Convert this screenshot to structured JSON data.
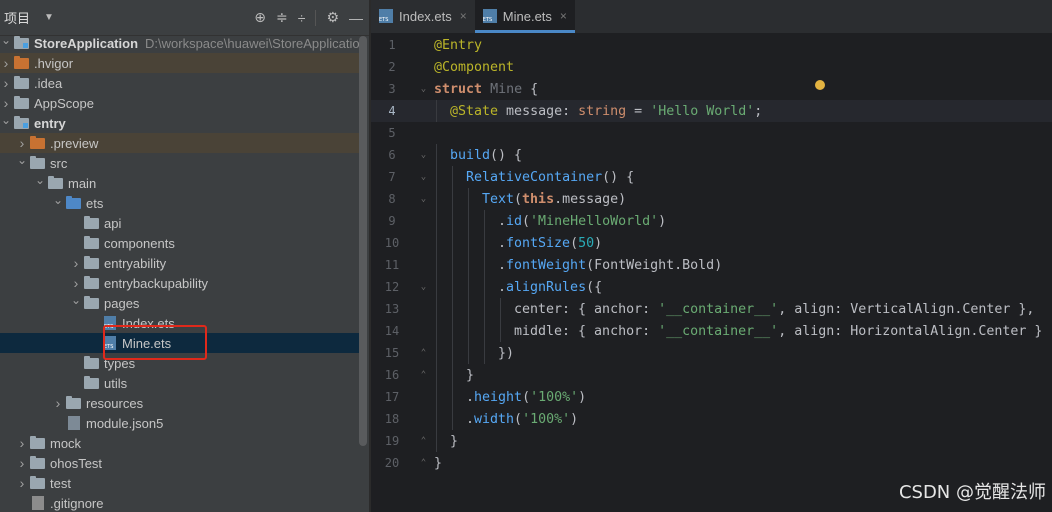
{
  "project": {
    "title": "项目",
    "dropdown_icon": "triangle-down-icon",
    "tools": [
      "locate-icon",
      "expand-all-icon",
      "collapse-all-icon",
      "settings-icon",
      "minimize-icon"
    ],
    "tree": [
      {
        "indent": 0,
        "arrow": "v",
        "icon": "module",
        "label": "StoreApplication",
        "bold": true,
        "path": "D:\\workspace\\huawei\\StoreApplication"
      },
      {
        "indent": 0,
        "arrow": ">",
        "icon": "orange",
        "label": ".hvigor",
        "hl": true
      },
      {
        "indent": 0,
        "arrow": ">",
        "icon": "folder",
        "label": ".idea"
      },
      {
        "indent": 0,
        "arrow": ">",
        "icon": "folder",
        "label": "AppScope"
      },
      {
        "indent": 0,
        "arrow": "v",
        "icon": "module",
        "label": "entry",
        "bold": true
      },
      {
        "indent": 1,
        "arrow": ">",
        "icon": "orange",
        "label": ".preview",
        "hl": true
      },
      {
        "indent": 1,
        "arrow": "v",
        "icon": "folder",
        "label": "src"
      },
      {
        "indent": 2,
        "arrow": "v",
        "icon": "folder",
        "label": "main"
      },
      {
        "indent": 3,
        "arrow": "v",
        "icon": "blue",
        "label": "ets"
      },
      {
        "indent": 4,
        "arrow": "",
        "icon": "folder",
        "label": "api"
      },
      {
        "indent": 4,
        "arrow": "",
        "icon": "folder",
        "label": "components"
      },
      {
        "indent": 4,
        "arrow": ">",
        "icon": "folder",
        "label": "entryability"
      },
      {
        "indent": 4,
        "arrow": ">",
        "icon": "folder",
        "label": "entrybackupability"
      },
      {
        "indent": 4,
        "arrow": "v",
        "icon": "folder",
        "label": "pages"
      },
      {
        "indent": 5,
        "arrow": "",
        "icon": "ets",
        "label": "Index.ets"
      },
      {
        "indent": 5,
        "arrow": "",
        "icon": "ets",
        "label": "Mine.ets",
        "sel": true
      },
      {
        "indent": 4,
        "arrow": "",
        "icon": "folder",
        "label": "types"
      },
      {
        "indent": 4,
        "arrow": "",
        "icon": "folder",
        "label": "utils"
      },
      {
        "indent": 3,
        "arrow": ">",
        "icon": "folder",
        "label": "resources"
      },
      {
        "indent": 3,
        "arrow": "",
        "icon": "json",
        "label": "module.json5"
      },
      {
        "indent": 1,
        "arrow": ">",
        "icon": "folder",
        "label": "mock"
      },
      {
        "indent": 1,
        "arrow": ">",
        "icon": "folder",
        "label": "ohosTest"
      },
      {
        "indent": 1,
        "arrow": ">",
        "icon": "folder",
        "label": "test"
      },
      {
        "indent": 1,
        "arrow": "",
        "icon": "git",
        "label": ".gitignore"
      }
    ]
  },
  "tabs": [
    {
      "label": "Index.ets",
      "active": false,
      "close": "×"
    },
    {
      "label": "Mine.ets",
      "active": true,
      "close": "×"
    }
  ],
  "code": [
    {
      "n": "1",
      "g": "",
      "ind": 0,
      "t": [
        [
          "ann",
          "@Entry"
        ]
      ]
    },
    {
      "n": "2",
      "g": "",
      "ind": 0,
      "t": [
        [
          "ann",
          "@Component"
        ]
      ]
    },
    {
      "n": "3",
      "g": "⌄",
      "ind": 0,
      "t": [
        [
          "kw",
          "struct"
        ],
        [
          "txt",
          " "
        ],
        [
          "cls",
          "Mine"
        ],
        [
          "txt",
          " {"
        ]
      ]
    },
    {
      "n": "4",
      "g": "",
      "ind": 1,
      "cur": true,
      "t": [
        [
          "ann",
          "@State"
        ],
        [
          "txt",
          " message: "
        ],
        [
          "ty",
          "string"
        ],
        [
          "txt",
          " = "
        ],
        [
          "str",
          "'Hello World'"
        ],
        [
          "txt",
          ";"
        ]
      ]
    },
    {
      "n": "5",
      "g": "",
      "ind": 0,
      "t": []
    },
    {
      "n": "6",
      "g": "⌄",
      "ind": 1,
      "t": [
        [
          "fn",
          "build"
        ],
        [
          "txt",
          "() {"
        ]
      ]
    },
    {
      "n": "7",
      "g": "⌄",
      "ind": 2,
      "t": [
        [
          "fn",
          "RelativeContainer"
        ],
        [
          "txt",
          "() {"
        ]
      ]
    },
    {
      "n": "8",
      "g": "⌄",
      "ind": 3,
      "t": [
        [
          "fn",
          "Text"
        ],
        [
          "txt",
          "("
        ],
        [
          "this",
          "this"
        ],
        [
          "txt",
          ".message)"
        ]
      ]
    },
    {
      "n": "9",
      "g": "",
      "ind": 4,
      "t": [
        [
          "txt",
          "."
        ],
        [
          "fn",
          "id"
        ],
        [
          "txt",
          "("
        ],
        [
          "str",
          "'MineHelloWorld'"
        ],
        [
          "txt",
          ")"
        ]
      ]
    },
    {
      "n": "10",
      "g": "",
      "ind": 4,
      "t": [
        [
          "txt",
          "."
        ],
        [
          "fn",
          "fontSize"
        ],
        [
          "txt",
          "("
        ],
        [
          "num",
          "50"
        ],
        [
          "txt",
          ")"
        ]
      ]
    },
    {
      "n": "11",
      "g": "",
      "ind": 4,
      "t": [
        [
          "txt",
          "."
        ],
        [
          "fn",
          "fontWeight"
        ],
        [
          "txt",
          "(FontWeight."
        ],
        [
          "txt",
          "Bold"
        ],
        [
          "txt",
          ")"
        ]
      ]
    },
    {
      "n": "12",
      "g": "⌄",
      "ind": 4,
      "t": [
        [
          "txt",
          "."
        ],
        [
          "fn",
          "alignRules"
        ],
        [
          "txt",
          "({"
        ]
      ]
    },
    {
      "n": "13",
      "g": "",
      "ind": 5,
      "t": [
        [
          "txt",
          "center: { anchor: "
        ],
        [
          "str",
          "'__container__'"
        ],
        [
          "txt",
          ", align: VerticalAlign.Center },"
        ]
      ]
    },
    {
      "n": "14",
      "g": "",
      "ind": 5,
      "t": [
        [
          "txt",
          "middle: { anchor: "
        ],
        [
          "str",
          "'__container__'"
        ],
        [
          "txt",
          ", align: HorizontalAlign.Center }"
        ]
      ]
    },
    {
      "n": "15",
      "g": "⌃",
      "ind": 4,
      "t": [
        [
          "txt",
          "})"
        ]
      ]
    },
    {
      "n": "16",
      "g": "⌃",
      "ind": 2,
      "t": [
        [
          "txt",
          "}"
        ]
      ]
    },
    {
      "n": "17",
      "g": "",
      "ind": 2,
      "t": [
        [
          "txt",
          "."
        ],
        [
          "fn",
          "height"
        ],
        [
          "txt",
          "("
        ],
        [
          "str",
          "'100%'"
        ],
        [
          "txt",
          ")"
        ]
      ]
    },
    {
      "n": "18",
      "g": "",
      "ind": 2,
      "t": [
        [
          "txt",
          "."
        ],
        [
          "fn",
          "width"
        ],
        [
          "txt",
          "("
        ],
        [
          "str",
          "'100%'"
        ],
        [
          "txt",
          ")"
        ]
      ]
    },
    {
      "n": "19",
      "g": "⌃",
      "ind": 1,
      "t": [
        [
          "txt",
          "}"
        ]
      ]
    },
    {
      "n": "20",
      "g": "⌃",
      "ind": 0,
      "t": [
        [
          "txt",
          "}"
        ]
      ]
    }
  ],
  "watermark": "CSDN @觉醒法师"
}
